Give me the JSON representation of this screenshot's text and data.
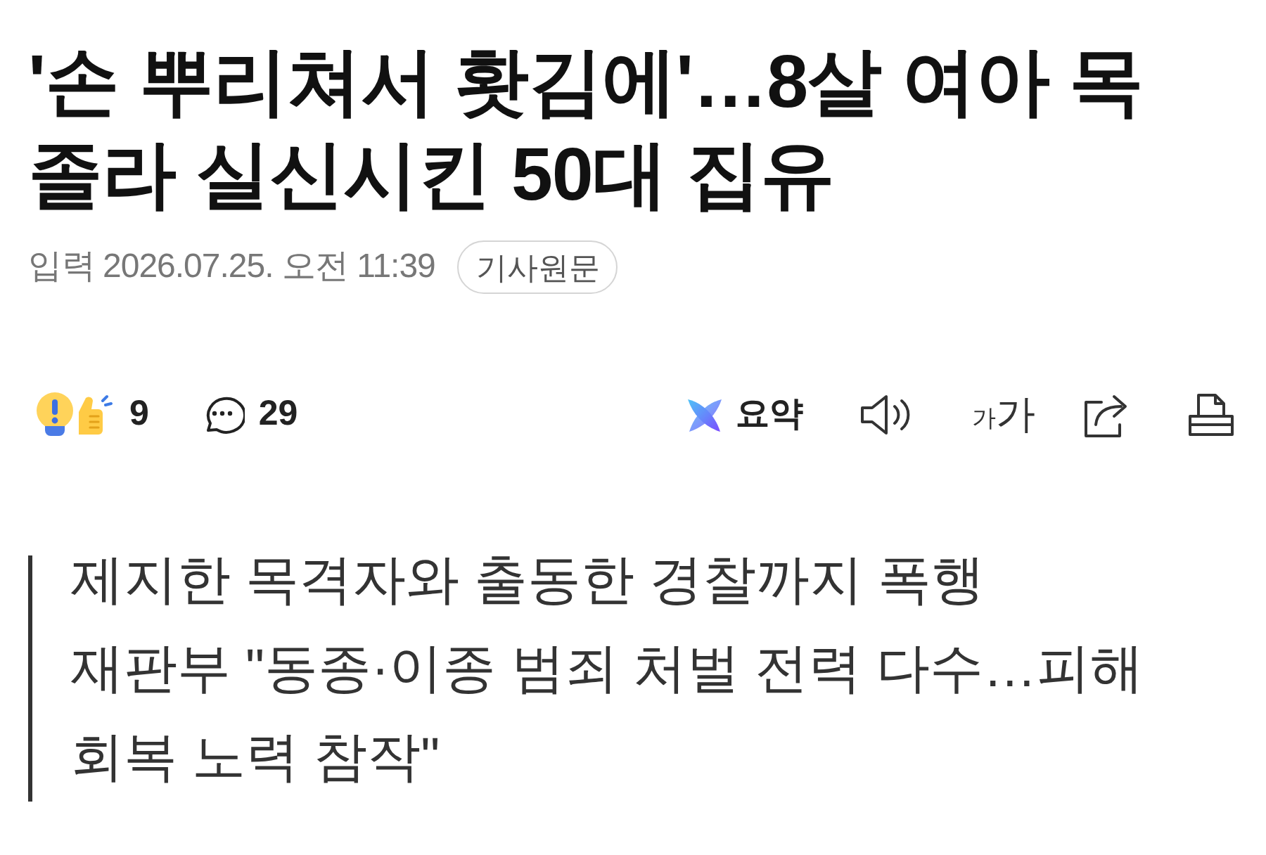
{
  "headline": {
    "lines": [
      "'손 뿌리쳐서 홧김에'…8살 여아 목",
      "졸라 실신시킨 50대 집유"
    ]
  },
  "published": {
    "label": "입력",
    "value": "2026.07.25. 오전 11:39"
  },
  "original_link": {
    "label": "기사원문"
  },
  "reactions": {
    "count": "9"
  },
  "comments": {
    "count": "29"
  },
  "toolbar": {
    "summary": {
      "label": "요약"
    },
    "font_size": {
      "small": "가",
      "large": "가"
    }
  },
  "subheadings": [
    "제지한 목격자와 출동한 경찰까지 폭행",
    "재판부 \"동종·이종 범죄 처벌 전력 다수…피해 회복 노력 참작\""
  ]
}
